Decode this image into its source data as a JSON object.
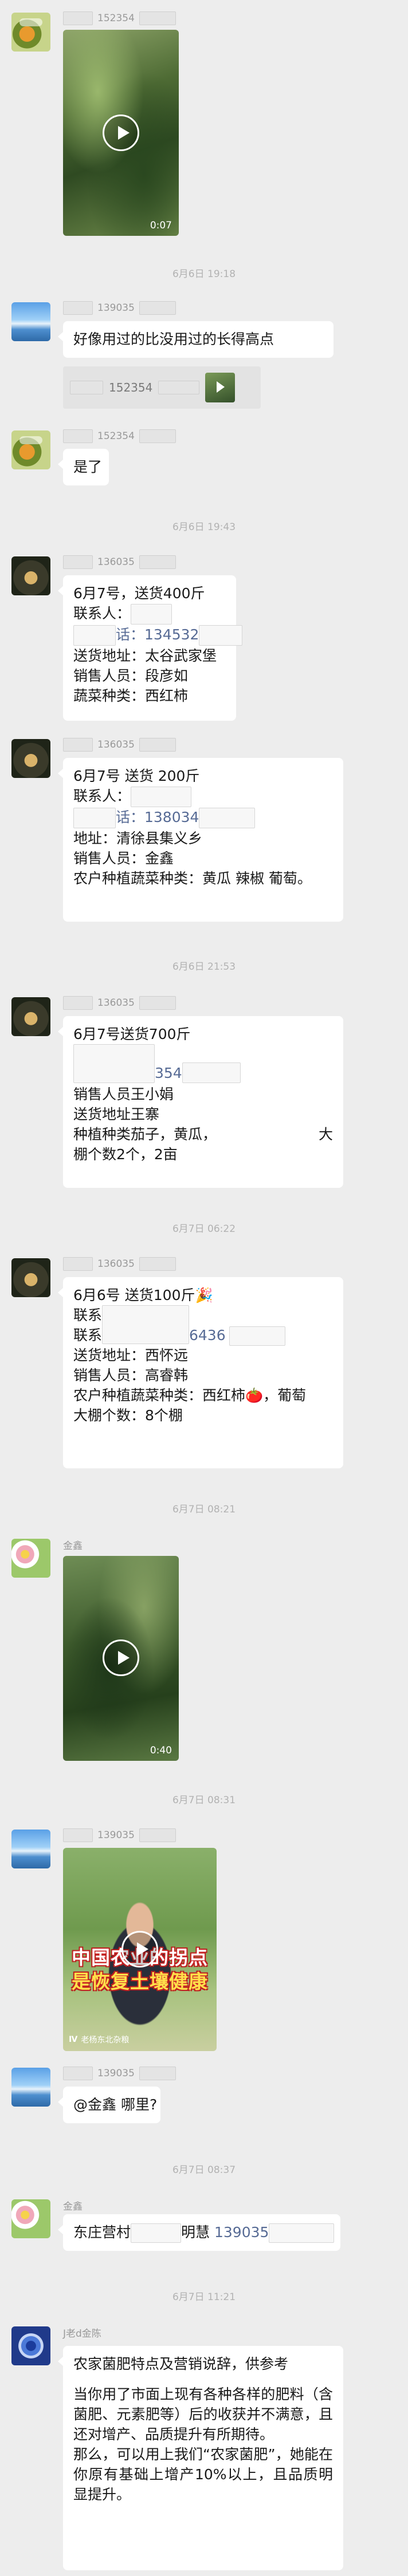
{
  "messages": {
    "m1": {
      "sender": "152354",
      "video_duration": "0:07"
    },
    "t1": "6月6日 19:18",
    "m2": {
      "sender": "139035",
      "text": "好像用过的比没用过的长得高点",
      "quote_sender": "152354"
    },
    "m3": {
      "sender": "152354",
      "text": "是了"
    },
    "t2": "6月6日 19:43",
    "m4": {
      "sender": "136035",
      "lines": [
        "6月7号，送货400斤",
        "联系人：",
        "话：134532",
        "送货地址：太谷武家堡",
        "销售人员：段彦如",
        "蔬菜种类：西红柿"
      ]
    },
    "m5": {
      "sender": "136035",
      "lines": [
        "6月7号  送货   200斤",
        "联系人：",
        "话：138034",
        "地址：清徐县集义乡",
        "销售人员：金鑫",
        "农户种植蔬菜种类：黄瓜 辣椒 葡萄。"
      ]
    },
    "t3": "6月6日 21:53",
    "m6": {
      "sender": "136035",
      "lines": [
        "6月7号送货700斤",
        "354",
        "销售人员王小娟",
        "送货地址王寨",
        "种植种类茄子，黄瓜，",
        "大",
        "棚个数2个，2亩"
      ]
    },
    "t4": "6月7日 06:22",
    "m7": {
      "sender": "136035",
      "lines": [
        "6月6号  送货100斤",
        "🎉",
        "联系",
        "联系",
        "6436",
        "送货地址：西怀远",
        "销售人员：高睿韩",
        "农户种植蔬菜种类：西红柿",
        "🍅",
        "，葡萄",
        "大棚个数：8个棚"
      ]
    },
    "t5": "6月7日 08:21",
    "m8": {
      "sender": "金鑫",
      "video_duration": "0:40"
    },
    "t6": "6月7日 08:31",
    "m9": {
      "sender": "139035",
      "overlay_line1": "中国农业的拐点",
      "overlay_line2": "是恢复土壤健康",
      "watermark": "老杨东北杂粮"
    },
    "m10": {
      "sender": "139035",
      "text": "@金鑫  哪里?"
    },
    "t7": "6月7日 08:37",
    "m11": {
      "sender": "金鑫",
      "text_prefix": "东庄营村",
      "text_mid": "明慧",
      "phone": "139035"
    },
    "t8": "6月7日 11:21",
    "m12": {
      "sender": "J老d金陈",
      "paragraphs": [
        "农家菌肥特点及营销说辞，供参考",
        "当你用了市面上现有各种各样的肥料（含菌肥、元素肥等）后的收获并不满意，且还对增产、品质提升有所期待。",
        "那么，可以用上我们“农家菌肥”，她能在你原有基础上增产10%以上，且品质明显提升。"
      ]
    }
  }
}
